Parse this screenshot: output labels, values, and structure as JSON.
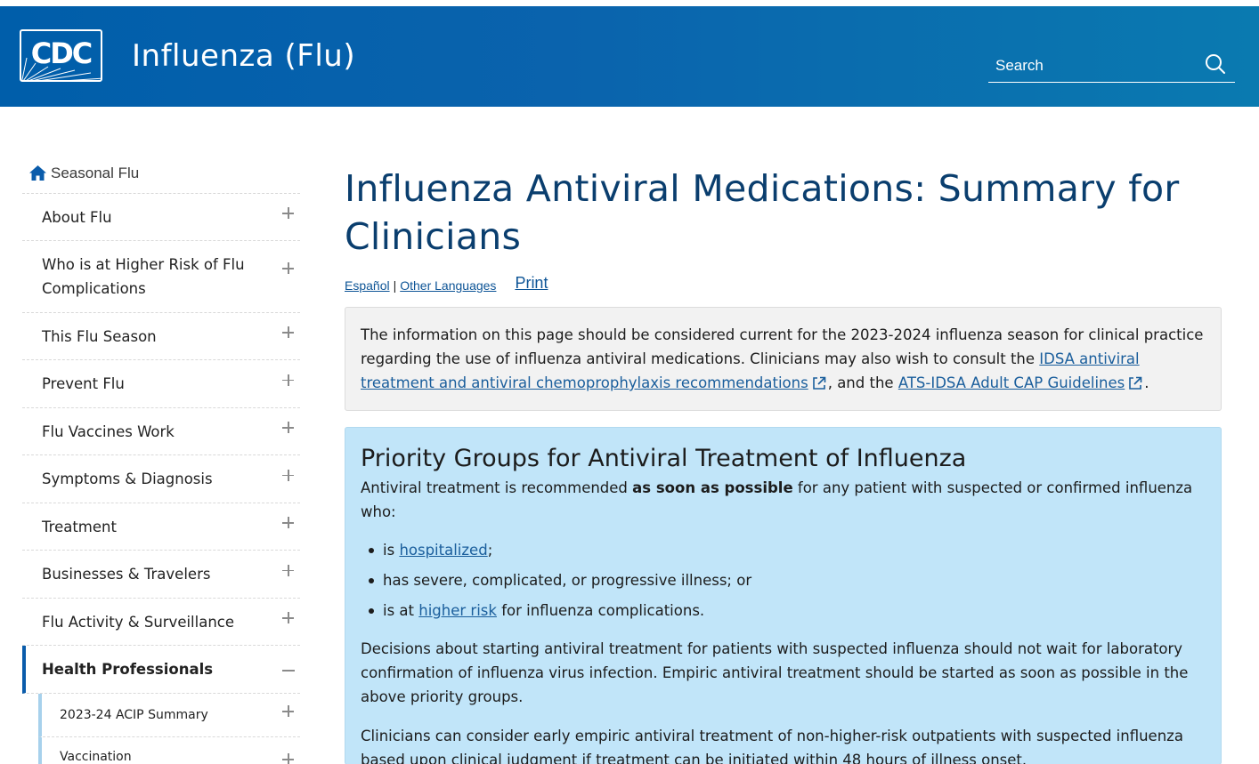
{
  "header": {
    "logo_text": "CDC",
    "site_title": "Influenza (Flu)",
    "search_placeholder": "Search"
  },
  "sidebar": {
    "home_label": "Seasonal Flu",
    "items": [
      {
        "label": "About Flu"
      },
      {
        "label": "Who is at Higher Risk of Flu Complications"
      },
      {
        "label": "This Flu Season"
      },
      {
        "label": "Prevent Flu"
      },
      {
        "label": "Flu Vaccines Work"
      },
      {
        "label": "Symptoms & Diagnosis"
      },
      {
        "label": "Treatment"
      },
      {
        "label": "Businesses & Travelers"
      },
      {
        "label": "Flu Activity & Surveillance"
      },
      {
        "label": "Health Professionals"
      }
    ],
    "subitems": [
      {
        "label": "2023-24 ACIP Summary"
      },
      {
        "label": "Vaccination"
      }
    ]
  },
  "main": {
    "title": "Influenza Antiviral Medications: Summary for Clinicians",
    "lang_espanol": "Español",
    "lang_sep": "|",
    "lang_other": "Other Languages",
    "print": "Print",
    "notice": {
      "text1": "The information on this page should be considered current for the 2023-2024 influenza season for clinical practice regarding the use of influenza antiviral medications. Clinicians may also wish to consult the ",
      "link1": "IDSA antiviral treatment and antiviral chemoprophylaxis recommendations",
      "text2": ", and the ",
      "link2": "ATS-IDSA Adult CAP Guidelines",
      "text3": "."
    },
    "priority": {
      "title": "Priority Groups for Antiviral Treatment of Influenza",
      "intro_pre": "Antiviral treatment is recommended ",
      "intro_bold": "as soon as possible",
      "intro_post": " for any patient with suspected or confirmed influenza who:",
      "b1_pre": "is ",
      "b1_link": "hospitalized",
      "b1_post": ";",
      "b2": "has severe, complicated, or progressive illness; or",
      "b3_pre": "is at ",
      "b3_link": "higher risk",
      "b3_post": " for influenza complications.",
      "para1": "Decisions about starting antiviral treatment for patients with suspected influenza should not wait for laboratory confirmation of influenza virus infection. Empiric antiviral treatment should be started as soon as possible in the above priority groups.",
      "para2": "Clinicians can consider early empiric antiviral treatment of non-higher-risk outpatients with suspected influenza based upon clinical judgment if treatment can be initiated within 48 hours of illness onset."
    }
  }
}
